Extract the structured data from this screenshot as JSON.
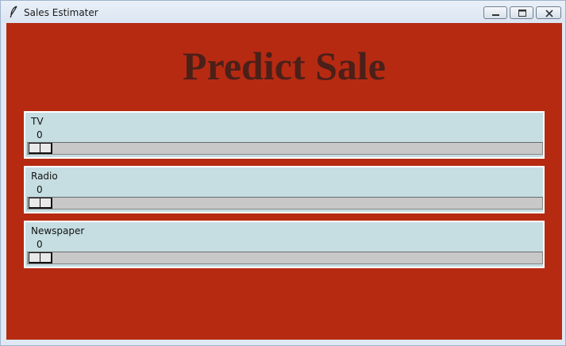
{
  "window": {
    "title": "Sales Estimater",
    "app_icon": "feather-icon",
    "controls": {
      "minimize_icon": "minimize-icon",
      "maximize_icon": "maximize-icon",
      "close_icon": "close-icon"
    }
  },
  "colors": {
    "background": "#b62a12",
    "heading": "#4b2019",
    "card": "#c6dee2",
    "trough": "#c8c8c8"
  },
  "heading": "Predict Sale",
  "sliders": [
    {
      "label": "TV",
      "value": "0",
      "level": 0
    },
    {
      "label": "Radio",
      "value": "0",
      "level": 0
    },
    {
      "label": "Newspaper",
      "value": "0",
      "level": 0
    }
  ]
}
